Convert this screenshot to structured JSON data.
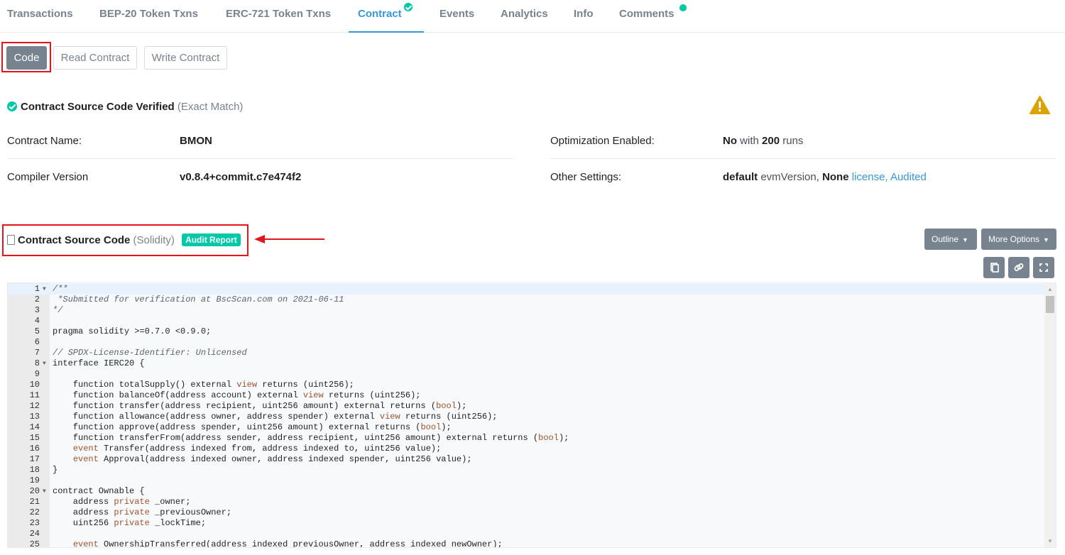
{
  "tabs": [
    {
      "label": "Transactions"
    },
    {
      "label": "BEP-20 Token Txns"
    },
    {
      "label": "ERC-721 Token Txns"
    },
    {
      "label": "Contract"
    },
    {
      "label": "Events"
    },
    {
      "label": "Analytics"
    },
    {
      "label": "Info"
    },
    {
      "label": "Comments"
    }
  ],
  "subtabs": {
    "code": "Code",
    "read": "Read Contract",
    "write": "Write Contract"
  },
  "verified": {
    "title": "Contract Source Code Verified",
    "note": "(Exact Match)"
  },
  "info": {
    "contract_name_label": "Contract Name:",
    "contract_name": "BMON",
    "compiler_label": "Compiler Version",
    "compiler": "v0.8.4+commit.c7e474f2",
    "optimization_label": "Optimization Enabled:",
    "optimization_value": "No",
    "optimization_with": "with",
    "optimization_runs": "200",
    "optimization_runs_suffix": "runs",
    "settings_label": "Other Settings:",
    "settings_default": "default",
    "settings_evm": "evmVersion,",
    "settings_none": "None",
    "settings_license": "license,",
    "settings_audited": "Audited"
  },
  "source": {
    "title": "Contract Source Code",
    "lang": "(Solidity)",
    "badge": "Audit Report",
    "outline": "Outline",
    "more_options": "More Options"
  },
  "colors": {
    "accent": "#3498db",
    "success": "#00c9a7",
    "warning": "#dba200",
    "highlight": "#e3141a",
    "button": "#77838f"
  },
  "code_lines": [
    {
      "n": "1",
      "t": "/**",
      "c": "cm",
      "fold": true
    },
    {
      "n": "2",
      "t": " *Submitted for verification at BscScan.com on 2021-06-11",
      "c": "cm"
    },
    {
      "n": "3",
      "t": "*/",
      "c": "cm"
    },
    {
      "n": "4",
      "t": ""
    },
    {
      "n": "5",
      "t": "pragma solidity >=0.7.0 <0.9.0;"
    },
    {
      "n": "6",
      "t": ""
    },
    {
      "n": "7",
      "t": "// SPDX-License-Identifier: Unlicensed",
      "c": "cm"
    },
    {
      "n": "8",
      "t": "interface IERC20 {",
      "fold": true
    },
    {
      "n": "9",
      "t": ""
    },
    {
      "n": "10",
      "t": "    function totalSupply() external view returns (uint256);"
    },
    {
      "n": "11",
      "t": "    function balanceOf(address account) external view returns (uint256);"
    },
    {
      "n": "12",
      "t": "    function transfer(address recipient, uint256 amount) external returns (bool);"
    },
    {
      "n": "13",
      "t": "    function allowance(address owner, address spender) external view returns (uint256);"
    },
    {
      "n": "14",
      "t": "    function approve(address spender, uint256 amount) external returns (bool);"
    },
    {
      "n": "15",
      "t": "    function transferFrom(address sender, address recipient, uint256 amount) external returns (bool);"
    },
    {
      "n": "16",
      "t": "    event Transfer(address indexed from, address indexed to, uint256 value);"
    },
    {
      "n": "17",
      "t": "    event Approval(address indexed owner, address indexed spender, uint256 value);"
    },
    {
      "n": "18",
      "t": "}"
    },
    {
      "n": "19",
      "t": ""
    },
    {
      "n": "20",
      "t": "contract Ownable {",
      "fold": true
    },
    {
      "n": "21",
      "t": "    address private _owner;"
    },
    {
      "n": "22",
      "t": "    address private _previousOwner;"
    },
    {
      "n": "23",
      "t": "    uint256 private _lockTime;"
    },
    {
      "n": "24",
      "t": ""
    },
    {
      "n": "25",
      "t": "    event OwnershipTransferred(address indexed previousOwner, address indexed newOwner);"
    }
  ]
}
